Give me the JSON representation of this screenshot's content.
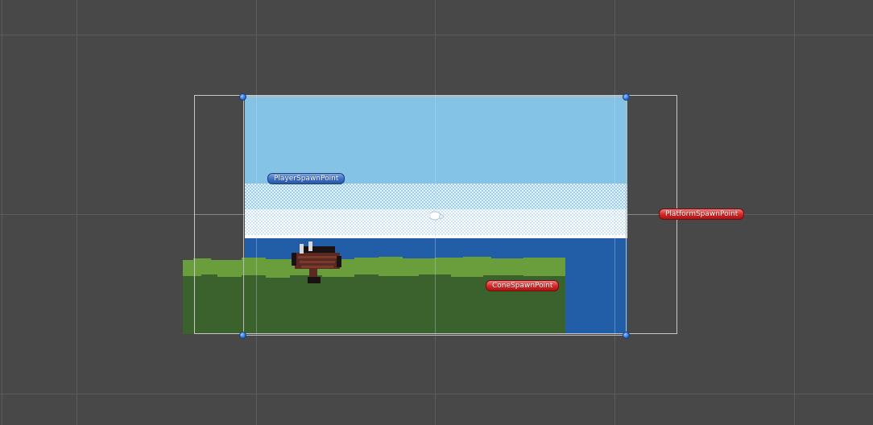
{
  "scene_view": {
    "background_color": "#484848",
    "grid_line_color": "#5e5e5e",
    "sky_color": "#85c3e6",
    "water_color": "#215ea7",
    "grass_light_color": "#6a9e3d",
    "grass_dark_color": "#3b622c",
    "camera_frame_color": "#c8c8c8"
  },
  "gizmos": {
    "player_spawn": {
      "label": "PlayerSpawnPoint",
      "color": "blue"
    },
    "platform_spawn": {
      "label": "PlatformSpawnPoint",
      "color": "red"
    },
    "cone_spawn": {
      "label": "ConeSpawnPoint",
      "color": "red"
    }
  },
  "icons": {
    "rect_handle": "blue-dot-handle",
    "pivot": "pivot-gizmo-icon",
    "player": "pixel-creature-sprite"
  }
}
